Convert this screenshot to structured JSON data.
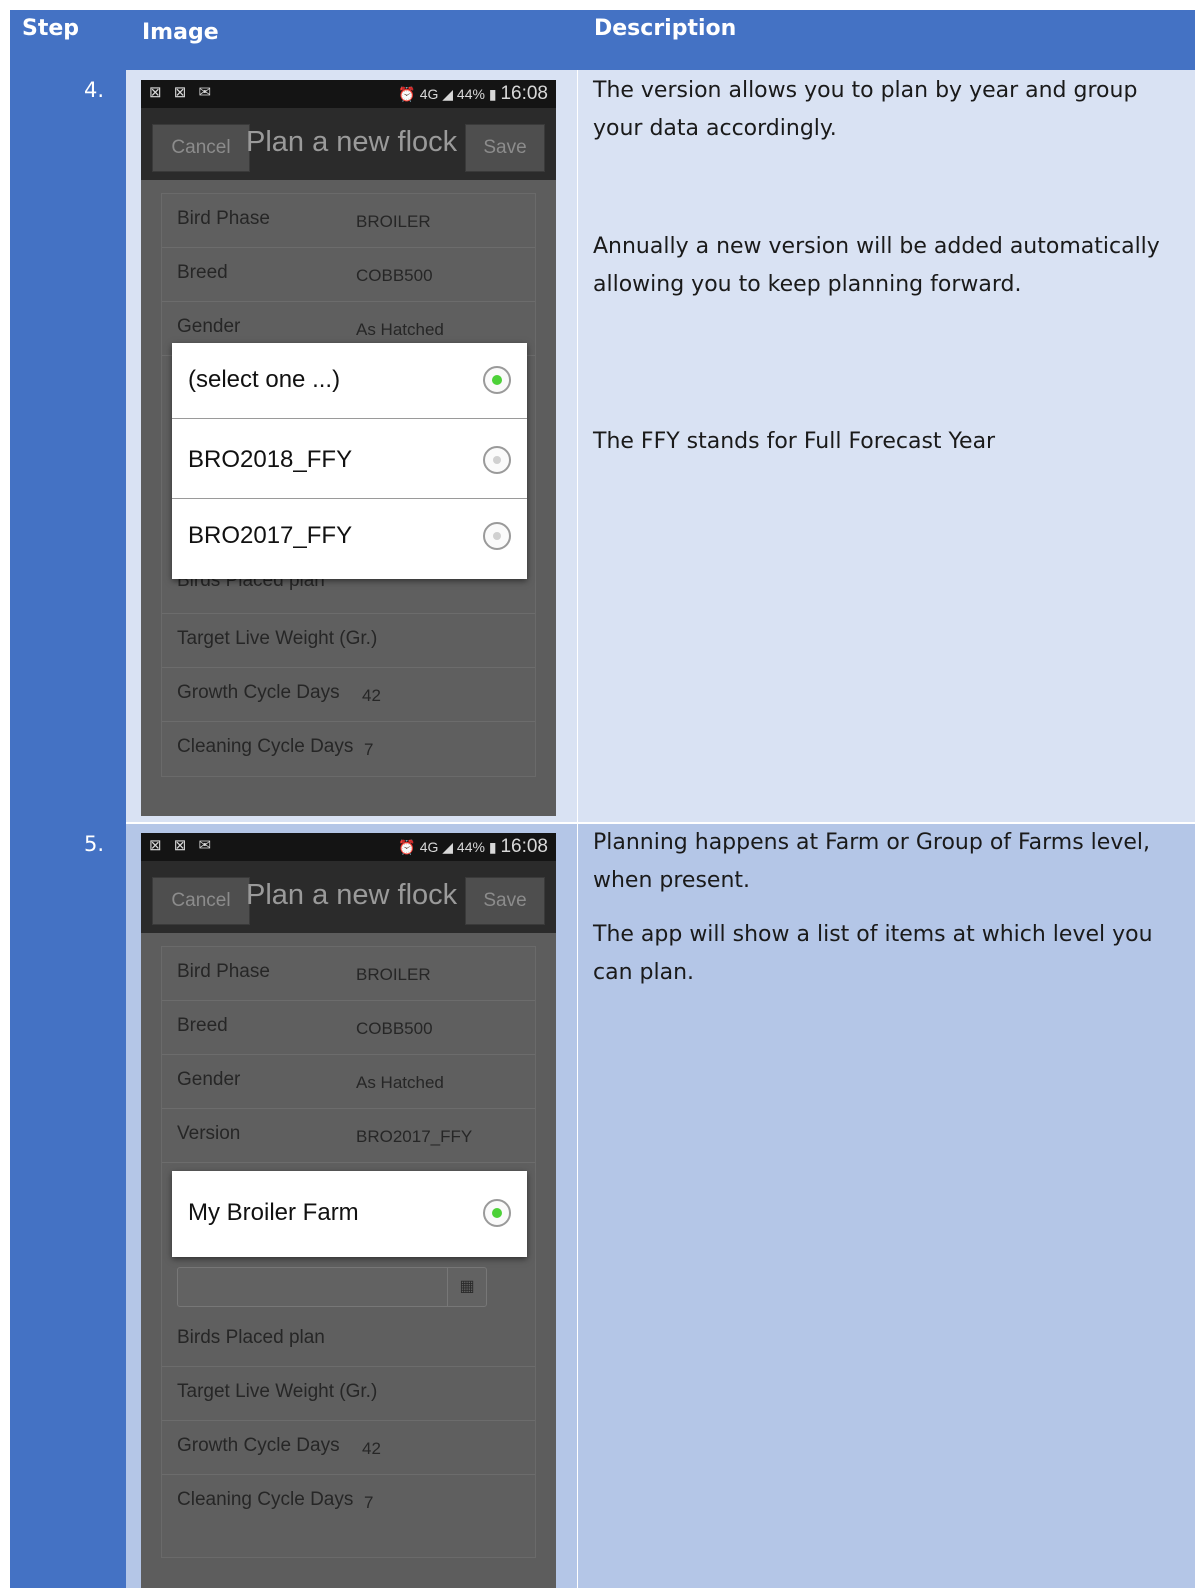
{
  "header": {
    "step": "Step",
    "image": "Image",
    "description": "Description"
  },
  "rows": [
    {
      "step": "4.",
      "description": [
        "The version allows you to plan by year and group your data accordingly.",
        "Annually a new version will be added automatically allowing you to keep planning forward.",
        "The FFY stands for Full Forecast Year"
      ],
      "phone": {
        "status_icons_left": "⊠ ⊠ ✉",
        "status_icons_right": "⏰ 4G ◢ 44% ▮",
        "time": "16:08",
        "cancel": "Cancel",
        "title": "Plan a new flock",
        "save": "Save",
        "fields": [
          {
            "label": "Bird Phase",
            "value": "BROILER"
          },
          {
            "label": "Breed",
            "value": "COBB500"
          },
          {
            "label": "Gender",
            "value": "As Hatched"
          },
          {
            "label": "Birds Placed plan",
            "value": ""
          },
          {
            "label": "Target Live Weight (Gr.)",
            "value": ""
          },
          {
            "label": "Growth Cycle Days",
            "value": "42"
          },
          {
            "label": "Cleaning Cycle Days",
            "value": "7"
          }
        ],
        "dialog_options": [
          {
            "label": "(select one ...)",
            "selected": true
          },
          {
            "label": "BRO2018_FFY",
            "selected": false
          },
          {
            "label": "BRO2017_FFY",
            "selected": false
          }
        ]
      }
    },
    {
      "step": "5.",
      "description": [
        "Planning happens at Farm or Group of Farms level, when present.",
        "The app will show a list of items at which level you can plan."
      ],
      "phone": {
        "status_icons_left": "⊠ ⊠ ✉",
        "status_icons_right": "⏰ 4G ◢ 44% ▮",
        "time": "16:08",
        "cancel": "Cancel",
        "title": "Plan a new flock",
        "save": "Save",
        "fields": [
          {
            "label": "Bird Phase",
            "value": "BROILER"
          },
          {
            "label": "Breed",
            "value": "COBB500"
          },
          {
            "label": "Gender",
            "value": "As Hatched"
          },
          {
            "label": "Version",
            "value": "BRO2017_FFY"
          },
          {
            "label": "Birds Placed plan",
            "value": ""
          },
          {
            "label": "Target Live Weight (Gr.)",
            "value": ""
          },
          {
            "label": "Growth Cycle Days",
            "value": "42"
          },
          {
            "label": "Cleaning Cycle Days",
            "value": "7"
          }
        ],
        "calendar_icon": "calendar-icon",
        "dialog_options": [
          {
            "label": "My Broiler Farm",
            "selected": true
          }
        ]
      }
    }
  ],
  "colors": {
    "header": "#4472c4",
    "row_light": "#d9e2f3",
    "row_dark": "#b4c6e7",
    "radio_selected": "#4cd137"
  }
}
